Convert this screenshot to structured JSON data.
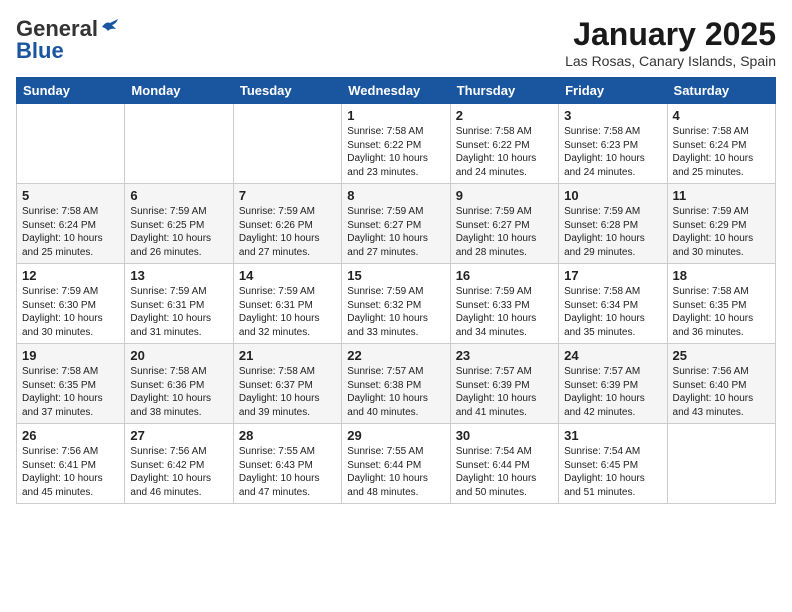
{
  "header": {
    "logo_line1": "General",
    "logo_line2": "Blue",
    "title": "January 2025",
    "subtitle": "Las Rosas, Canary Islands, Spain"
  },
  "weekdays": [
    "Sunday",
    "Monday",
    "Tuesday",
    "Wednesday",
    "Thursday",
    "Friday",
    "Saturday"
  ],
  "weeks": [
    {
      "shaded": false,
      "days": [
        {
          "date": "",
          "info": ""
        },
        {
          "date": "",
          "info": ""
        },
        {
          "date": "",
          "info": ""
        },
        {
          "date": "1",
          "info": "Sunrise: 7:58 AM\nSunset: 6:22 PM\nDaylight: 10 hours\nand 23 minutes."
        },
        {
          "date": "2",
          "info": "Sunrise: 7:58 AM\nSunset: 6:22 PM\nDaylight: 10 hours\nand 24 minutes."
        },
        {
          "date": "3",
          "info": "Sunrise: 7:58 AM\nSunset: 6:23 PM\nDaylight: 10 hours\nand 24 minutes."
        },
        {
          "date": "4",
          "info": "Sunrise: 7:58 AM\nSunset: 6:24 PM\nDaylight: 10 hours\nand 25 minutes."
        }
      ]
    },
    {
      "shaded": true,
      "days": [
        {
          "date": "5",
          "info": "Sunrise: 7:58 AM\nSunset: 6:24 PM\nDaylight: 10 hours\nand 25 minutes."
        },
        {
          "date": "6",
          "info": "Sunrise: 7:59 AM\nSunset: 6:25 PM\nDaylight: 10 hours\nand 26 minutes."
        },
        {
          "date": "7",
          "info": "Sunrise: 7:59 AM\nSunset: 6:26 PM\nDaylight: 10 hours\nand 27 minutes."
        },
        {
          "date": "8",
          "info": "Sunrise: 7:59 AM\nSunset: 6:27 PM\nDaylight: 10 hours\nand 27 minutes."
        },
        {
          "date": "9",
          "info": "Sunrise: 7:59 AM\nSunset: 6:27 PM\nDaylight: 10 hours\nand 28 minutes."
        },
        {
          "date": "10",
          "info": "Sunrise: 7:59 AM\nSunset: 6:28 PM\nDaylight: 10 hours\nand 29 minutes."
        },
        {
          "date": "11",
          "info": "Sunrise: 7:59 AM\nSunset: 6:29 PM\nDaylight: 10 hours\nand 30 minutes."
        }
      ]
    },
    {
      "shaded": false,
      "days": [
        {
          "date": "12",
          "info": "Sunrise: 7:59 AM\nSunset: 6:30 PM\nDaylight: 10 hours\nand 30 minutes."
        },
        {
          "date": "13",
          "info": "Sunrise: 7:59 AM\nSunset: 6:31 PM\nDaylight: 10 hours\nand 31 minutes."
        },
        {
          "date": "14",
          "info": "Sunrise: 7:59 AM\nSunset: 6:31 PM\nDaylight: 10 hours\nand 32 minutes."
        },
        {
          "date": "15",
          "info": "Sunrise: 7:59 AM\nSunset: 6:32 PM\nDaylight: 10 hours\nand 33 minutes."
        },
        {
          "date": "16",
          "info": "Sunrise: 7:59 AM\nSunset: 6:33 PM\nDaylight: 10 hours\nand 34 minutes."
        },
        {
          "date": "17",
          "info": "Sunrise: 7:58 AM\nSunset: 6:34 PM\nDaylight: 10 hours\nand 35 minutes."
        },
        {
          "date": "18",
          "info": "Sunrise: 7:58 AM\nSunset: 6:35 PM\nDaylight: 10 hours\nand 36 minutes."
        }
      ]
    },
    {
      "shaded": true,
      "days": [
        {
          "date": "19",
          "info": "Sunrise: 7:58 AM\nSunset: 6:35 PM\nDaylight: 10 hours\nand 37 minutes."
        },
        {
          "date": "20",
          "info": "Sunrise: 7:58 AM\nSunset: 6:36 PM\nDaylight: 10 hours\nand 38 minutes."
        },
        {
          "date": "21",
          "info": "Sunrise: 7:58 AM\nSunset: 6:37 PM\nDaylight: 10 hours\nand 39 minutes."
        },
        {
          "date": "22",
          "info": "Sunrise: 7:57 AM\nSunset: 6:38 PM\nDaylight: 10 hours\nand 40 minutes."
        },
        {
          "date": "23",
          "info": "Sunrise: 7:57 AM\nSunset: 6:39 PM\nDaylight: 10 hours\nand 41 minutes."
        },
        {
          "date": "24",
          "info": "Sunrise: 7:57 AM\nSunset: 6:39 PM\nDaylight: 10 hours\nand 42 minutes."
        },
        {
          "date": "25",
          "info": "Sunrise: 7:56 AM\nSunset: 6:40 PM\nDaylight: 10 hours\nand 43 minutes."
        }
      ]
    },
    {
      "shaded": false,
      "days": [
        {
          "date": "26",
          "info": "Sunrise: 7:56 AM\nSunset: 6:41 PM\nDaylight: 10 hours\nand 45 minutes."
        },
        {
          "date": "27",
          "info": "Sunrise: 7:56 AM\nSunset: 6:42 PM\nDaylight: 10 hours\nand 46 minutes."
        },
        {
          "date": "28",
          "info": "Sunrise: 7:55 AM\nSunset: 6:43 PM\nDaylight: 10 hours\nand 47 minutes."
        },
        {
          "date": "29",
          "info": "Sunrise: 7:55 AM\nSunset: 6:44 PM\nDaylight: 10 hours\nand 48 minutes."
        },
        {
          "date": "30",
          "info": "Sunrise: 7:54 AM\nSunset: 6:44 PM\nDaylight: 10 hours\nand 50 minutes."
        },
        {
          "date": "31",
          "info": "Sunrise: 7:54 AM\nSunset: 6:45 PM\nDaylight: 10 hours\nand 51 minutes."
        },
        {
          "date": "",
          "info": ""
        }
      ]
    }
  ]
}
